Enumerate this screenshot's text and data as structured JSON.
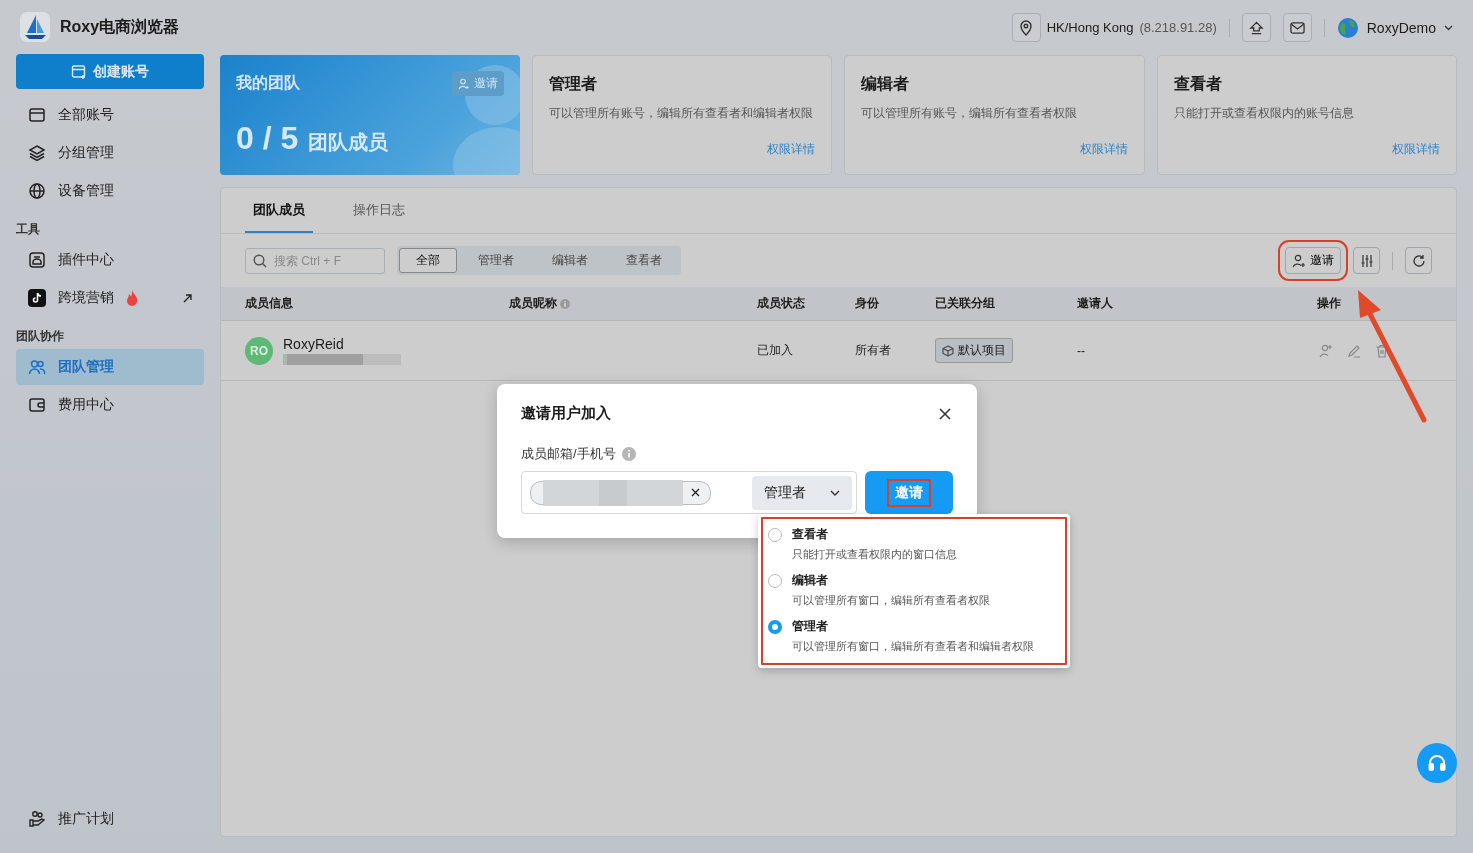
{
  "app": {
    "name": "Roxy电商浏览器"
  },
  "header": {
    "location": "HK/Hong Kong",
    "ip": "(8.218.91.28)",
    "user": "RoxyDemo"
  },
  "sidebar": {
    "create_button": "创建账号",
    "groups": [
      {
        "items": [
          {
            "label": "全部账号",
            "selected": false,
            "hot": false,
            "external": false
          },
          {
            "label": "分组管理",
            "selected": false,
            "hot": false,
            "external": false
          },
          {
            "label": "设备管理",
            "selected": false,
            "hot": false,
            "external": false
          }
        ]
      },
      {
        "title": "工具",
        "items": [
          {
            "label": "插件中心",
            "selected": false,
            "hot": false,
            "external": false
          },
          {
            "label": "跨境营销",
            "selected": false,
            "hot": true,
            "external": true
          }
        ]
      },
      {
        "title": "团队协作",
        "items": [
          {
            "label": "团队管理",
            "selected": true,
            "hot": false,
            "external": false
          },
          {
            "label": "费用中心",
            "selected": false,
            "hot": false,
            "external": false
          }
        ]
      }
    ],
    "footer_item": "推广计划"
  },
  "team_card": {
    "title": "我的团队",
    "invite": "邀请",
    "count": "0 / 5",
    "count_label": "团队成员"
  },
  "role_cards": [
    {
      "title": "管理者",
      "description": "可以管理所有账号，编辑所有查看者和编辑者权限",
      "link": "权限详情"
    },
    {
      "title": "编辑者",
      "description": "可以管理所有账号，编辑所有查看者权限",
      "link": "权限详情"
    },
    {
      "title": "查看者",
      "description": "只能打开或查看权限内的账号信息",
      "link": "权限详情"
    }
  ],
  "tabs": [
    {
      "label": "团队成员",
      "selected": true
    },
    {
      "label": "操作日志",
      "selected": false
    }
  ],
  "search": {
    "placeholder": "搜索 Ctrl + F"
  },
  "filters": [
    {
      "label": "全部",
      "selected": true
    },
    {
      "label": "管理者",
      "selected": false
    },
    {
      "label": "编辑者",
      "selected": false
    },
    {
      "label": "查看者",
      "selected": false
    }
  ],
  "toolbar": {
    "invite": "邀请"
  },
  "table": {
    "columns": [
      {
        "label": "成员信息",
        "info": false
      },
      {
        "label": "成员昵称",
        "info": true
      },
      {
        "label": "成员状态",
        "info": false
      },
      {
        "label": "身份",
        "info": false
      },
      {
        "label": "已关联分组",
        "info": false
      },
      {
        "label": "邀请人",
        "info": false
      },
      {
        "label": "操作",
        "info": false
      }
    ],
    "rows": [
      {
        "avatar": "RO",
        "name": "RoxyReid",
        "status": "已加入",
        "role": "所有者",
        "group": "默认项目",
        "inviter": "--"
      }
    ]
  },
  "dialog": {
    "title": "邀请用户加入",
    "field_label": "成员邮箱/手机号",
    "role": "管理者",
    "invite_button": "邀请",
    "options": [
      {
        "title": "查看者",
        "description": "只能打开或查看权限内的窗口信息",
        "selected": false
      },
      {
        "title": "编辑者",
        "description": "可以管理所有窗口，编辑所有查看者权限",
        "selected": false
      },
      {
        "title": "管理者",
        "description": "可以管理所有窗口，编辑所有查看者和编辑者权限",
        "selected": true
      }
    ]
  }
}
